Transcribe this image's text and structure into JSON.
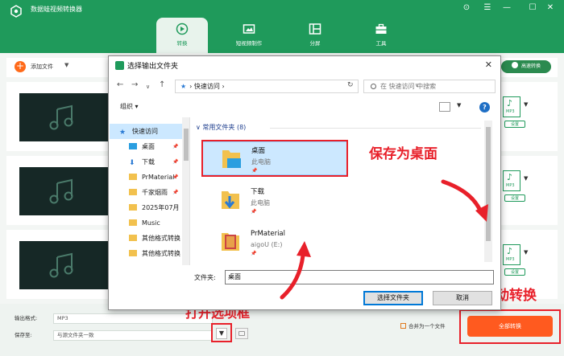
{
  "app": {
    "title": "数据蛙视频转换器",
    "window_controls": [
      "⊙",
      "☰",
      "—",
      "☐",
      "✕"
    ],
    "nav_tabs": [
      {
        "label": "转换",
        "icon": "convert-icon",
        "active": true
      },
      {
        "label": "短视频制作",
        "icon": "film-icon",
        "active": false
      },
      {
        "label": "分屏",
        "icon": "split-screen-icon",
        "active": false
      },
      {
        "label": "工具",
        "icon": "toolbox-icon",
        "active": false
      }
    ],
    "add_file_label": "添加文件",
    "fast_convert_label": "高速转换",
    "format_ext": "MP3",
    "format_label": "设置",
    "output_format_label": "输出格式:",
    "output_format_value": "MP3",
    "save_to_label": "保存至:",
    "save_to_value": "与源文件夹一致",
    "merge_label": "合并为一个文件",
    "start_all_label": "全部转换"
  },
  "annotations": {
    "save_desktop": "保存为桌面",
    "start_convert": "启动转换",
    "open_options": "打开选项框"
  },
  "colors": {
    "brand": "#1f9a5b",
    "accent": "#ff5a1f",
    "annotation": "#e8202a",
    "selection": "#cce8ff"
  },
  "dialog": {
    "title": "选择输出文件夹",
    "address": "快速访问",
    "search_placeholder": "在 快速访问 中搜索",
    "organize_label": "组织 ▾",
    "group_header": "常用文件夹 (8)",
    "sidebar": [
      {
        "label": "快速访问",
        "icon": "star-icon",
        "pinned": false
      },
      {
        "label": "桌面",
        "icon": "desktop-icon",
        "pinned": true
      },
      {
        "label": "下载",
        "icon": "download-icon",
        "pinned": true
      },
      {
        "label": "PrMaterial",
        "icon": "folder-icon",
        "pinned": true
      },
      {
        "label": "千家烟雨",
        "icon": "folder-icon",
        "pinned": true
      },
      {
        "label": "2025年07月",
        "icon": "folder-icon",
        "pinned": false
      },
      {
        "label": "Music",
        "icon": "folder-icon",
        "pinned": false
      },
      {
        "label": "其他格式转换",
        "icon": "folder-icon",
        "pinned": false
      },
      {
        "label": "其他格式转换",
        "icon": "folder-icon",
        "pinned": false
      }
    ],
    "pin_glyph": "📌",
    "items": [
      {
        "name": "桌面",
        "sub": "此电脑",
        "selected": true
      },
      {
        "name": "下载",
        "sub": "此电脑",
        "selected": false
      },
      {
        "name": "PrMaterial",
        "sub": "aigoU (E:)",
        "selected": false
      }
    ],
    "filename_label": "文件夹:",
    "filename_value": "桌面",
    "select_button": "选择文件夹",
    "cancel_button": "取消"
  }
}
